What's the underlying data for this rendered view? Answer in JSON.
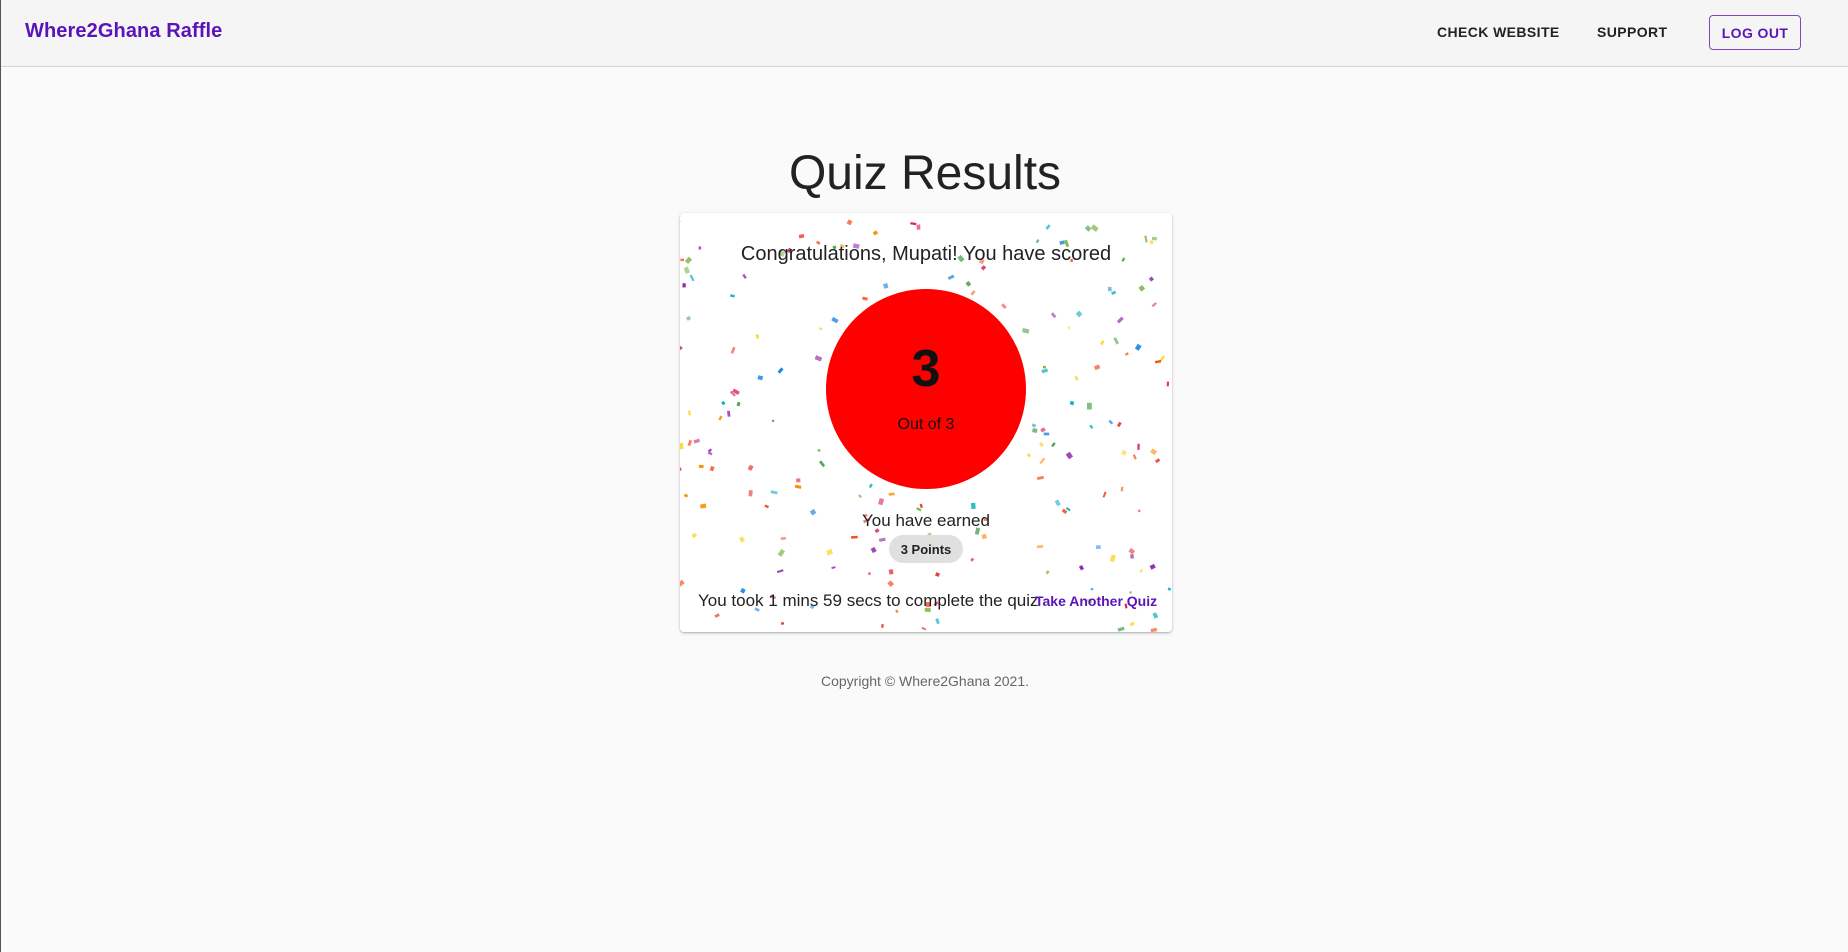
{
  "header": {
    "brand": "Where2Ghana Raffle",
    "nav": {
      "check_website": "CHECK WEBSITE",
      "support": "SUPPORT",
      "logout": "LOG OUT"
    }
  },
  "main": {
    "title": "Quiz Results",
    "card": {
      "congrats": "Congratulations, Mupati! You have scored",
      "score": "3",
      "score_out_of": "Out of 3",
      "earned_label": "You have earned",
      "points_chip": "3 Points",
      "time_text": "You took 1 mins 59 secs to complete the quiz",
      "take_another": "Take Another Quiz"
    }
  },
  "footer": {
    "copyright": "Copyright © Where2Ghana 2021."
  },
  "colors": {
    "brand": "#5b14b8",
    "score_circle": "#ff0000",
    "chip_bg": "#e0e0e0",
    "confetti": [
      "#e53935",
      "#43a047",
      "#1e88e5",
      "#fb8c00",
      "#8e24aa",
      "#fdd835",
      "#00acc1",
      "#d81b60",
      "#7cb342",
      "#f4511e"
    ]
  }
}
